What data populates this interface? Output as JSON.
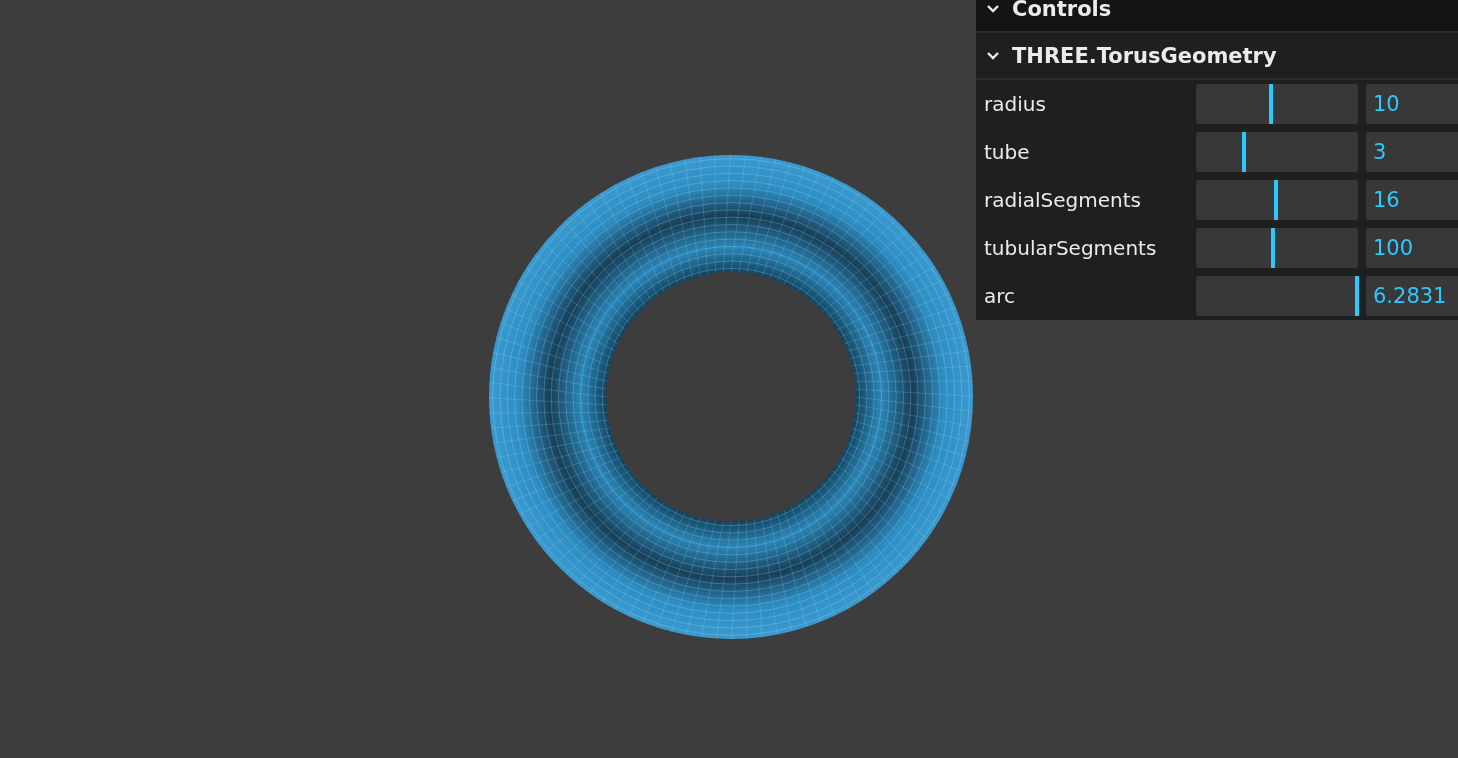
{
  "folders": [
    {
      "title": "Controls",
      "expanded": true
    },
    {
      "title": "THREE.TorusGeometry",
      "expanded": true,
      "controls": [
        {
          "label": "radius",
          "level": 0.47,
          "value": "10"
        },
        {
          "label": "tube",
          "level": 0.3,
          "value": "3"
        },
        {
          "label": "radialSegments",
          "level": 0.5,
          "value": "16"
        },
        {
          "label": "tubularSegments",
          "level": 0.48,
          "value": "100"
        },
        {
          "label": "arc",
          "level": 1,
          "value": "6.2831"
        }
      ]
    }
  ]
}
